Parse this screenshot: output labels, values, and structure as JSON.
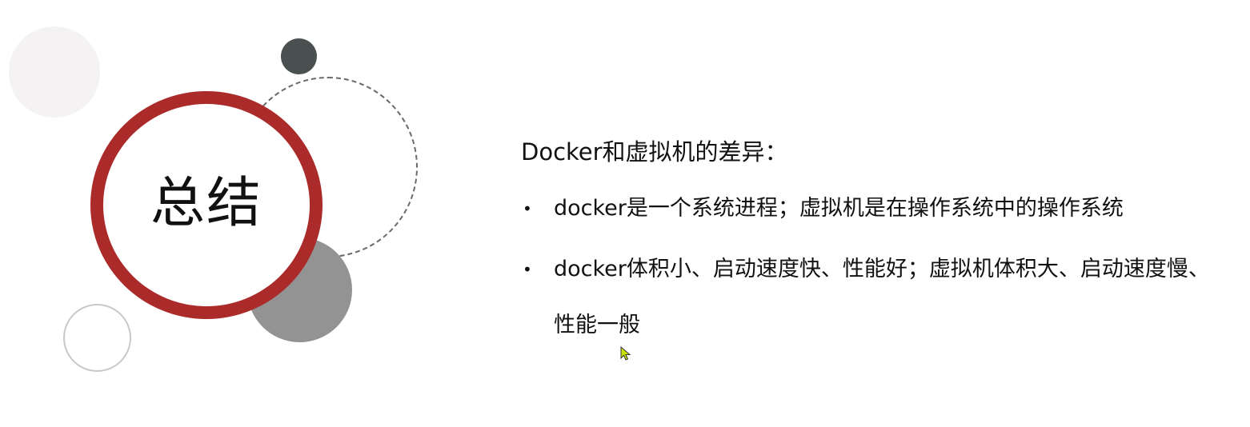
{
  "slide": {
    "title": "总结",
    "heading": "Docker和虚拟机的差异：",
    "bullets": [
      "docker是一个系统进程；虚拟机是在操作系统中的操作系统",
      "docker体积小、启动速度快、性能好；虚拟机体积大、启动速度慢、性能一般"
    ],
    "bullet_glyph": "•"
  },
  "colors": {
    "accent_ring": "#ab2a2a",
    "dark_circle": "#4a4f4f",
    "gray_circle": "#939393",
    "light_circle": "#f4f2f2"
  },
  "icons": {
    "cursor": "mouse-pointer-icon"
  }
}
